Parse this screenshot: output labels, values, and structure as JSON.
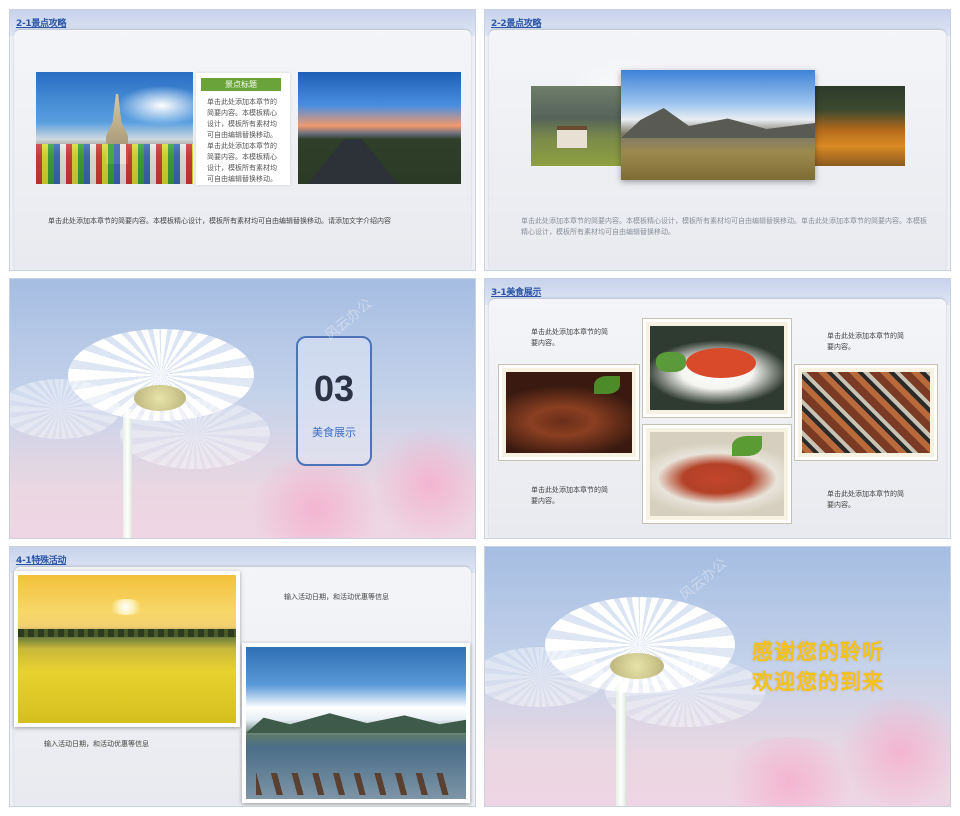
{
  "slides": [
    {
      "title": "2-1景点攻略",
      "box_title": "景点标题",
      "box_text": "单击此处添加本章节的简要内容。本模板精心设计，模板所有素材均可自由编辑替换移动。单击此处添加本章节的简要内容。本模板精心设计，模板所有素材均可自由编辑替换移动。",
      "caption": "单击此处添加本章节的简要内容。本模板精心设计，模板所有素材均可自由编辑替换移动。请添加文字介绍内容"
    },
    {
      "title": "2-2景点攻略",
      "caption": "单击此处添加本章节的简要内容。本模板精心设计，模板所有素材均可自由编辑替换移动。单击此处添加本章节的简要内容。本模板精心设计，模板所有素材均可自由编辑替换移动。"
    },
    {
      "section_number": "03",
      "section_title": "美食展示"
    },
    {
      "title": "3-1美食展示",
      "captions": [
        "单击此处添加本章节的简要内容。",
        "单击此处添加本章节的简要内容。",
        "单击此处添加本章节的简要内容。",
        "单击此处添加本章节的简要内容。"
      ]
    },
    {
      "title": "4-1特殊活动",
      "caption_top": "输入活动日期，和活动优惠等信息",
      "caption_bottom": "输入活动日期，和活动优惠等信息"
    },
    {
      "thanks_line1": "感谢您的聆听",
      "thanks_line2": "欢迎您的到来"
    }
  ],
  "colors": {
    "accent_blue": "#2a55a8",
    "box_green": "#6aa33a",
    "thanks_yellow": "#f5c21b",
    "section_blue": "#3f6fc6"
  },
  "icons": [
    "daisy-image",
    "photo"
  ]
}
